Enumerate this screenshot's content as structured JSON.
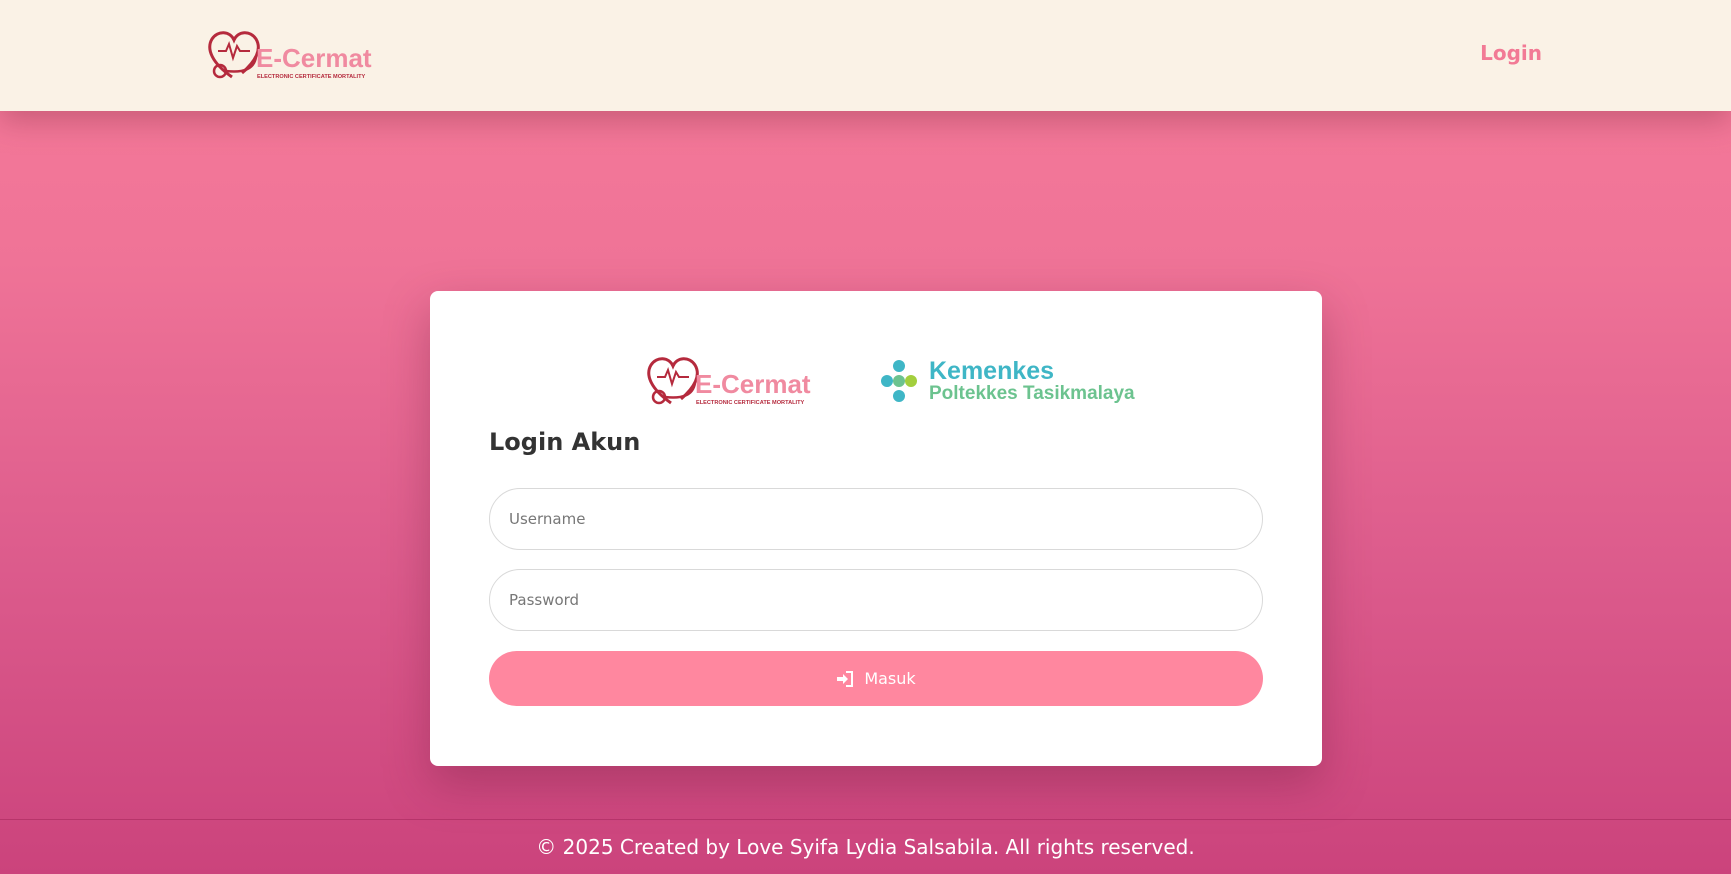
{
  "navbar": {
    "logo": {
      "wordmark": "E-Cermat",
      "tagline": "ELECTRONIC CERTIFICATE MORTALITY"
    },
    "login_link": "Login"
  },
  "card": {
    "logos": {
      "ecermat": {
        "wordmark": "E-Cermat",
        "tagline": "ELECTRONIC CERTIFICATE MORTALITY"
      },
      "kemenkes": {
        "title": "Kemenkes",
        "subtitle": "Poltekkes Tasikmalaya"
      }
    },
    "title": "Login Akun",
    "username": {
      "placeholder": "Username",
      "value": ""
    },
    "password": {
      "placeholder": "Password",
      "value": ""
    },
    "submit": {
      "label": "Masuk",
      "icon": "sign-in-icon"
    }
  },
  "footer": {
    "text": "© 2025 Created by Love Syifa Lydia Salsabila. All rights reserved."
  },
  "colors": {
    "navbar_bg": "#faf2e6",
    "accent": "#f27a95",
    "button": "#ff879f",
    "logo_red": "#b52a3d",
    "logo_pink": "#f08aa0",
    "kemenkes_teal": "#3fb6c6",
    "kemenkes_green": "#6cc38f"
  }
}
